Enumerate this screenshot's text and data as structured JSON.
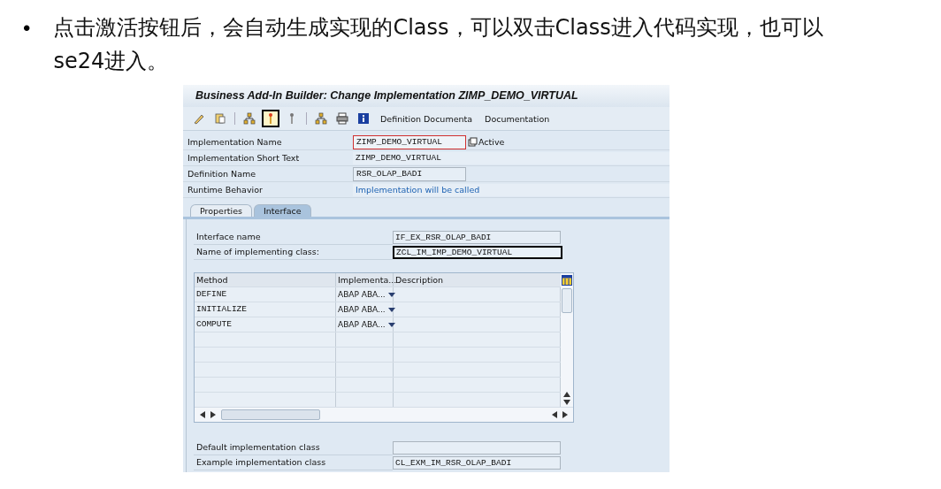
{
  "bullet": {
    "marker": "•",
    "text": "点击激活按钮后，会自动生成实现的Class，可以双击Class进入代码实现，也可以se24进入。"
  },
  "window": {
    "title": "Business Add-In Builder: Change Implementation ZIMP_DEMO_VIRTUAL"
  },
  "toolbar": {
    "icons": [
      {
        "kind": "pencil",
        "highlighted": false
      },
      {
        "kind": "other",
        "highlighted": false
      },
      {
        "kind": "separator"
      },
      {
        "kind": "hierarchy",
        "highlighted": false
      },
      {
        "kind": "activate",
        "highlighted": true
      },
      {
        "kind": "deactivate",
        "highlighted": false
      },
      {
        "kind": "separator"
      },
      {
        "kind": "tree",
        "highlighted": false
      },
      {
        "kind": "printer",
        "highlighted": false
      },
      {
        "kind": "info",
        "highlighted": false
      }
    ],
    "buttons": [
      "Definition Documenta",
      "Documentation"
    ]
  },
  "header_fields": [
    {
      "label": "Implementation Name",
      "value": "ZIMP_DEMO_VIRTUAL",
      "kind": "input",
      "focused": true,
      "status": "Active"
    },
    {
      "label": "Implementation Short Text",
      "value": "ZIMP_DEMO_VIRTUAL",
      "kind": "wide",
      "focused": false
    },
    {
      "label": "Definition Name",
      "value": "RSR_OLAP_BADI",
      "kind": "input",
      "focused": false
    },
    {
      "label": "Runtime Behavior",
      "value": "Implementation will be called",
      "kind": "link",
      "focused": false
    }
  ],
  "tabs": [
    {
      "label": "Properties",
      "selected": false
    },
    {
      "label": "Interface",
      "selected": true
    }
  ],
  "interface_fields": [
    {
      "label": "Interface name",
      "value": "IF_EX_RSR_OLAP_BADI",
      "highlighted": false
    },
    {
      "label": "Name of implementing class:",
      "value": "ZCL_IM_IMP_DEMO_VIRTUAL",
      "highlighted": true
    }
  ],
  "table": {
    "columns": [
      "Method",
      "Implementa...",
      "Description"
    ],
    "rows": [
      {
        "method": "DEFINE",
        "implementation": "ABAP ABA..."
      },
      {
        "method": "INITIALIZE",
        "implementation": "ABAP ABA..."
      },
      {
        "method": "COMPUTE",
        "implementation": "ABAP ABA..."
      }
    ]
  },
  "class_fields": [
    {
      "label": "Default implementation class"
    },
    {
      "label": "Example implementation class",
      "value": "CL_EXM_IM_RSR_OLAP_BADI"
    }
  ]
}
